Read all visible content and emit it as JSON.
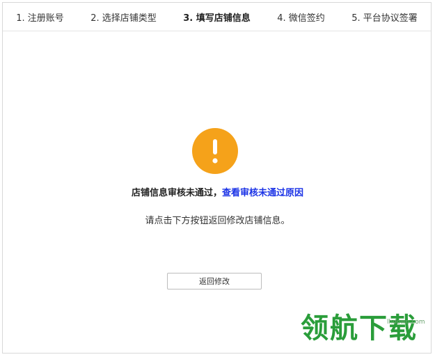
{
  "steps": [
    {
      "label": "1. 注册账号"
    },
    {
      "label": "2. 选择店铺类型"
    },
    {
      "label": "3. 填写店铺信息"
    },
    {
      "label": "4. 微信签约"
    },
    {
      "label": "5. 平台协议签署"
    }
  ],
  "active_step": 3,
  "alert_icon": {
    "name": "exclamation-icon",
    "color": "#f5a21a"
  },
  "message": {
    "text": "店铺信息审核未通过，",
    "link_text": "查看审核未通过原因",
    "link_color": "#1a32e6"
  },
  "instruction": "请点击下方按钮返回修改店铺信息。",
  "back_button_label": "返回修改",
  "watermark": {
    "logo_text": "领航下载",
    "url_text": "lhdown.com",
    "color": "#2a9d3a"
  }
}
